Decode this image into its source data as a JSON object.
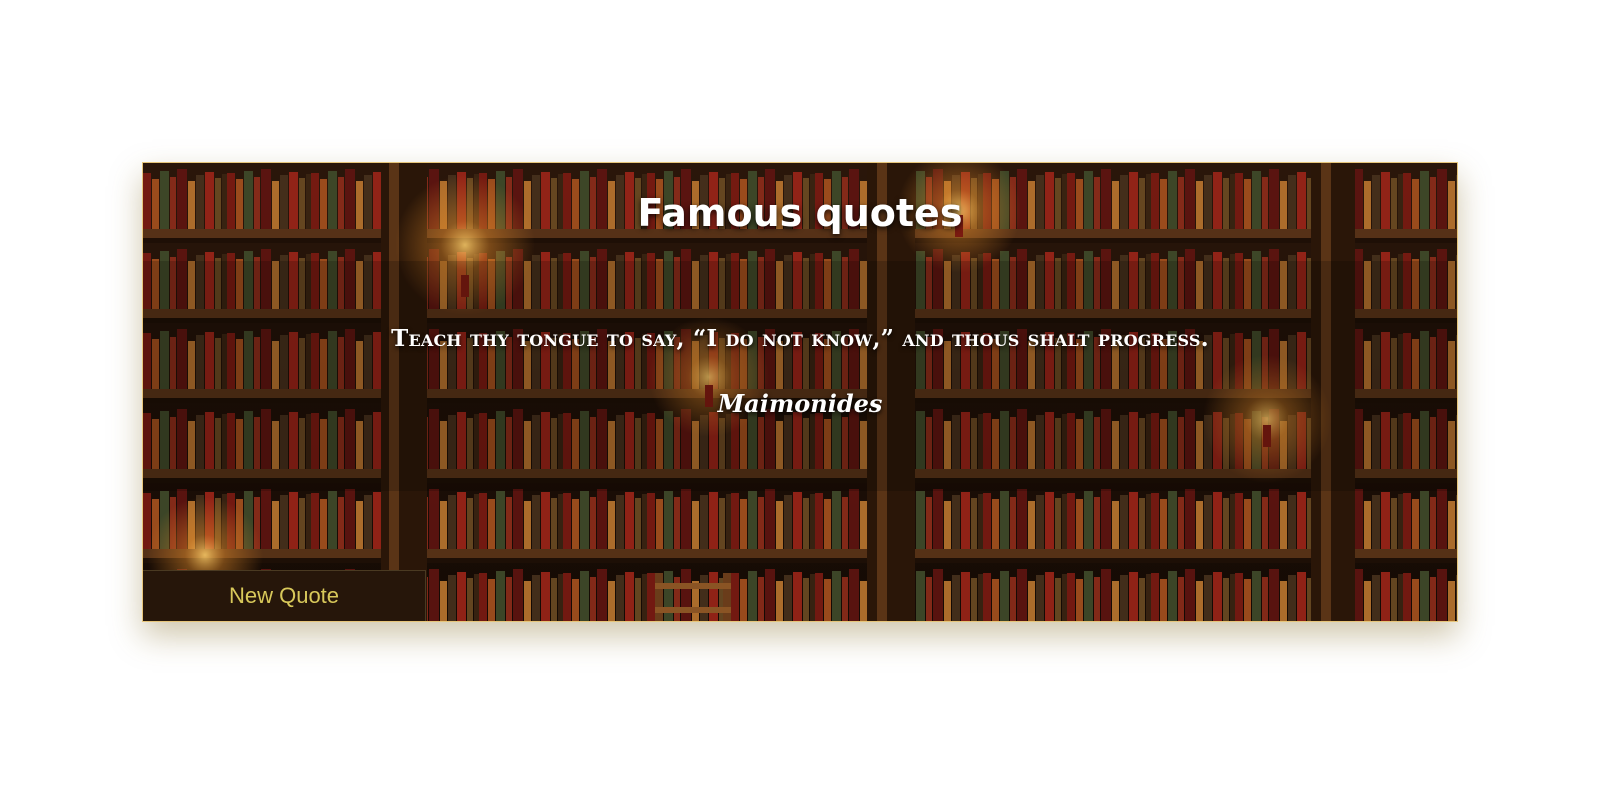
{
  "page": {
    "title": "Famous quotes"
  },
  "quote": {
    "text": "Teach thy tongue to say, “I do not know,” and thous shalt progress.",
    "author": "Maimonides"
  },
  "actions": {
    "new_quote_label": "New Quote"
  },
  "colors": {
    "border": "#e6c57a",
    "button_bg": "#26160a",
    "button_text": "#d8c85a",
    "text": "#ffffff"
  },
  "background": {
    "subject": "library bookshelves with candles"
  }
}
